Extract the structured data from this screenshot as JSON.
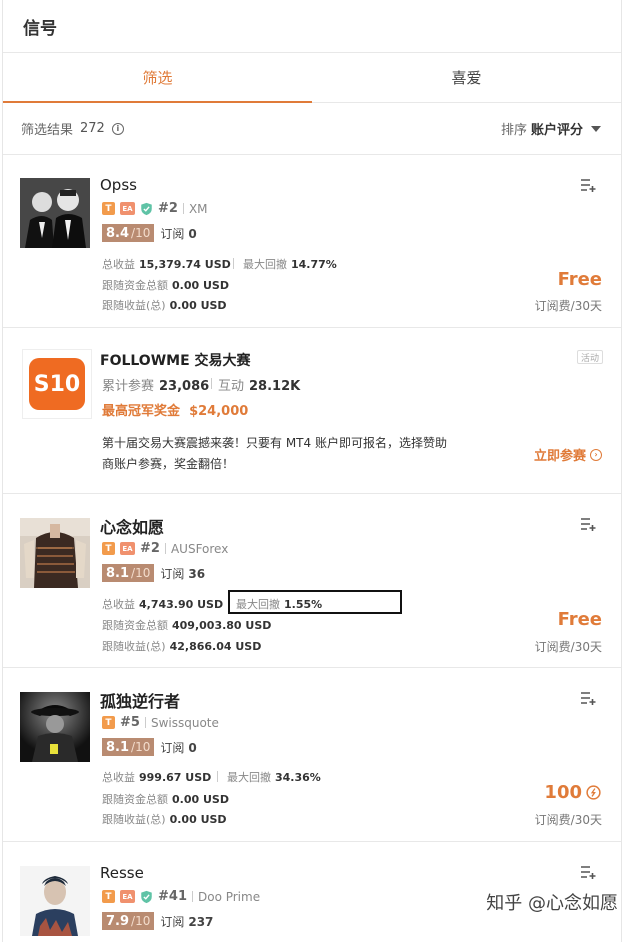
{
  "header": {
    "title": "信号"
  },
  "tabs": [
    {
      "label": "筛选",
      "active": true
    },
    {
      "label": "喜爱",
      "active": false
    }
  ],
  "filter": {
    "label": "筛选结果",
    "count": "272",
    "sort_label": "排序",
    "sort_value": "账户评分"
  },
  "signals": [
    {
      "name": "Opss",
      "rank": "#2",
      "broker": "XM",
      "verified": true,
      "score": "8.4",
      "score_den": "/10",
      "subs_label": "订阅",
      "subs": "0",
      "profit_label": "总收益",
      "profit": "15,379.74 USD",
      "dd_label": "最大回撤",
      "dd": "14.77%",
      "follow_funds_label": "跟随资金总额",
      "follow_funds": "0.00 USD",
      "follow_profit_label": "跟随收益(总)",
      "follow_profit": "0.00 USD",
      "price": "Free",
      "period": "订阅费/30天"
    },
    {
      "name": "心念如愿",
      "rank": "#2",
      "broker": "AUSForex",
      "verified": false,
      "score": "8.1",
      "score_den": "/10",
      "subs_label": "订阅",
      "subs": "36",
      "profit_label": "总收益",
      "profit": "4,743.90 USD",
      "dd_label": "最大回撤",
      "dd": "1.55%",
      "follow_funds_label": "跟随资金总额",
      "follow_funds": "409,003.80 USD",
      "follow_profit_label": "跟随收益(总)",
      "follow_profit": "42,866.04 USD",
      "price": "Free",
      "period": "订阅费/30天"
    },
    {
      "name": "孤独逆行者",
      "rank": "#5",
      "broker": "Swissquote",
      "verified": false,
      "score": "8.1",
      "score_den": "/10",
      "subs_label": "订阅",
      "subs": "0",
      "profit_label": "总收益",
      "profit": "999.67 USD",
      "dd_label": "最大回撤",
      "dd": "34.36%",
      "follow_funds_label": "跟随资金总额",
      "follow_funds": "0.00 USD",
      "follow_profit_label": "跟随收益(总)",
      "follow_profit": "0.00 USD",
      "price": "100",
      "period": "订阅费/30天"
    },
    {
      "name": "Resse",
      "rank": "#41",
      "broker": "Doo Prime",
      "verified": true,
      "score": "7.9",
      "score_den": "/10",
      "subs_label": "订阅",
      "subs": "237"
    }
  ],
  "promo": {
    "logo_text": "S10",
    "title": "FOLLOWME 交易大赛",
    "tag": "活动",
    "participants_label": "累计参赛",
    "participants": "23,086",
    "interact_label": "互动",
    "interact": "28.12K",
    "prize_label": "最高冠军奖金",
    "prize": "$24,000",
    "desc": "第十届交易大赛震撼来袭！只要有 MT4 账户即可报名，选择赞助商账户参赛，奖金翻倍！",
    "join_label": "立即参赛"
  },
  "badges": {
    "t": "T",
    "ea": "EA"
  },
  "watermark": "知乎 @心念如愿",
  "colors": {
    "accent": "#e07b39",
    "score_bg": "#b98b71",
    "t_badge": "#f29b4c",
    "ea_badge": "#f0916e",
    "verified": "#5fc3a6"
  }
}
